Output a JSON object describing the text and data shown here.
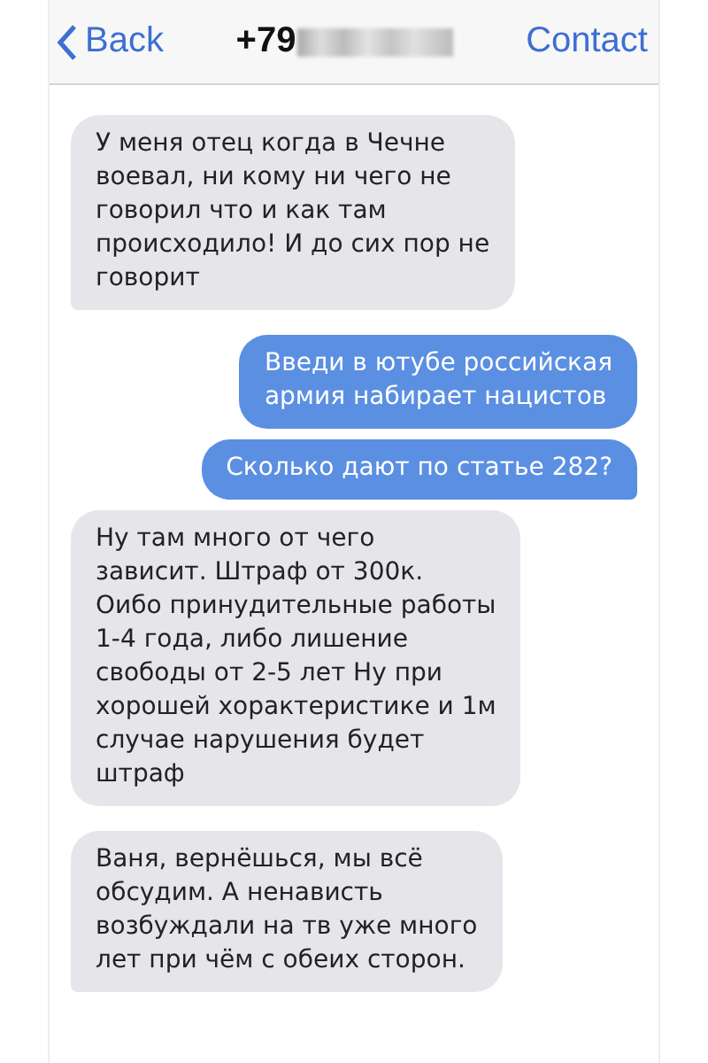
{
  "header": {
    "back": "Back",
    "title": "+79",
    "contact": "Contact"
  },
  "messages": [
    {
      "kind": "incoming",
      "text": "У меня отец когда в Чечне\nвоевал, ни кому ни чего не\nговорил что и как там\nпроисходило! И до сих пор не\nговорит",
      "tail": true
    },
    {
      "kind": "outgoing",
      "text": "Введи в ютубе российская\nармия набирает нацистов",
      "tail": false
    },
    {
      "kind": "outgoing",
      "text": "Сколько дают по статье 282?",
      "tail": true
    },
    {
      "kind": "incoming",
      "text": "Ну там много от чего\nзависит. Штраф от 300к.\nОибо принудительные работы\n1-4 года, либо лишение\nсвободы от 2-5 лет  Ну при\nхорошей хорактеристике и 1м\nслучае нарушения будет\nштраф",
      "tail": false
    },
    {
      "kind": "incoming",
      "text": "Ваня, вернёшься, мы всё\nобсудим. А ненависть\nвозбуждали на тв уже много\nлет при чём с обеих сторон.",
      "tail": true
    }
  ]
}
